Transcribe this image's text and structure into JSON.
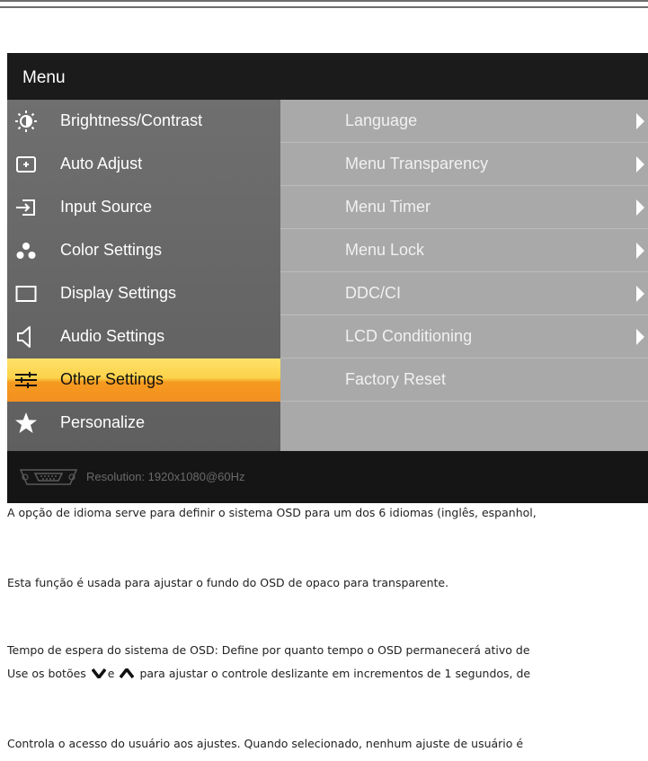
{
  "osd": {
    "title": "Menu",
    "menu_items": [
      {
        "label": "Brightness/Contrast",
        "icon": "brightness-icon"
      },
      {
        "label": "Auto Adjust",
        "icon": "auto-adjust-icon"
      },
      {
        "label": "Input Source",
        "icon": "input-source-icon"
      },
      {
        "label": "Color Settings",
        "icon": "color-settings-icon"
      },
      {
        "label": "Display Settings",
        "icon": "display-settings-icon"
      },
      {
        "label": "Audio Settings",
        "icon": "speaker-icon"
      },
      {
        "label": "Other Settings",
        "icon": "other-settings-icon",
        "selected": true
      },
      {
        "label": "Personalize",
        "icon": "star-icon"
      }
    ],
    "sub_items": [
      {
        "label": "Language",
        "has_arrow": true
      },
      {
        "label": "Menu Transparency",
        "has_arrow": true
      },
      {
        "label": "Menu Timer",
        "has_arrow": true
      },
      {
        "label": "Menu Lock",
        "has_arrow": true
      },
      {
        "label": "DDC/CI",
        "has_arrow": true
      },
      {
        "label": "LCD Conditioning",
        "has_arrow": true
      },
      {
        "label": "Factory Reset",
        "has_arrow": false
      }
    ],
    "status": {
      "resolution": "Resolution: 1920x1080@60Hz",
      "icon": "vga-connector-icon"
    },
    "colors": {
      "selected_top": "#ffe26a",
      "selected_bottom": "#f39020",
      "panel_left": "#666666",
      "panel_right": "#a9a9a9"
    }
  },
  "descriptions": {
    "language": "A opção de idioma serve para definir o sistema OSD para um dos 6 idiomas (inglês, espanhol,",
    "transparency": "Esta função é usada para ajustar o fundo do OSD de opaco para transparente.",
    "timer_line1": "Tempo de espera do sistema de OSD: Define por quanto tempo o OSD permanecerá ativo de",
    "timer_line2_prefix": "Use os botões",
    "timer_line2_and": "e",
    "timer_line2_suffix": "para ajustar o controle deslizante em incrementos de 1 segundos, de",
    "lock": "Controla o acesso do usuário aos ajustes. Quando selecionado, nenhum ajuste de usuário é"
  }
}
